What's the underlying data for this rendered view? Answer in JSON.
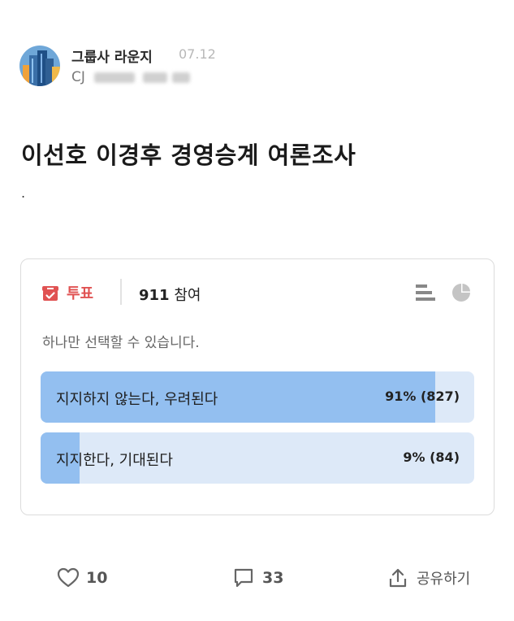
{
  "post": {
    "author": "그룹사 라운지",
    "date": "07.12",
    "company": "CJ",
    "title": "이선호 이경후 경영승계 여론조사",
    "body": "."
  },
  "poll": {
    "type_label": "투표",
    "participant_count": "911",
    "participant_suffix": "참여",
    "instruction": "하나만 선택할 수 있습니다.",
    "options": [
      {
        "label": "지지하지 않는다, 우려된다",
        "result": "91% (827)",
        "percent": 91
      },
      {
        "label": "지지한다, 기대된다",
        "result": "9% (84)",
        "percent": 9
      }
    ]
  },
  "actions": {
    "likes": "10",
    "comments": "33",
    "share": "공유하기"
  },
  "colors": {
    "poll_accent": "#e05252",
    "bar_fill": "#93bff0",
    "bar_track": "#dde9f8"
  }
}
